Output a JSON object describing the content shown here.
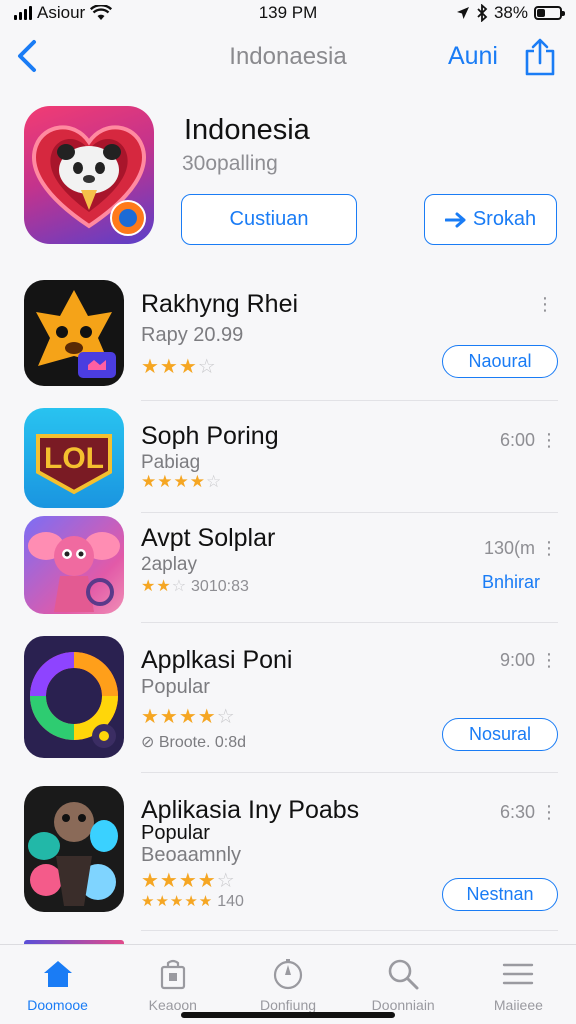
{
  "status_bar": {
    "carrier": "Asiour",
    "time": "139 PM",
    "battery": "38%",
    "battery_level": 0.38
  },
  "nav": {
    "title": "Indonaesia",
    "action": "Auni"
  },
  "hero": {
    "title": "Indonesia",
    "subtitle": "30opalling",
    "button_primary": "Custiuan",
    "button_secondary": "Srokah"
  },
  "apps": [
    {
      "name": "Rakhyng Rhei",
      "subtitle": "Rapy 20.99",
      "rating": 3.5,
      "stars": "★★★",
      "stars_off": "☆",
      "rating_count": "",
      "meta": "⋮",
      "button": "Naoural"
    },
    {
      "name": "Soph Poring",
      "subtitle": "Pabiag",
      "rating": 3.5,
      "stars": "★★★★",
      "stars_off": "☆",
      "rating_count": "",
      "meta": "6:00 ⋮",
      "button": ""
    },
    {
      "name": "Avpt Solplar",
      "subtitle": "2aplay",
      "rating": 2.5,
      "stars": "★★",
      "stars_off": "☆",
      "rating_count": "3010:83",
      "meta": "130(m ⋮",
      "link": "Bnhirar"
    },
    {
      "name": "Applkasi Poni",
      "subtitle": "Popular",
      "rating": 4,
      "stars": "★★★★",
      "stars_off": "☆",
      "extra": "⊘ Broote. 0:8d",
      "meta": "9:00 ⋮",
      "button": "Nosural"
    },
    {
      "name": "Aplikasia Iny Poabs",
      "subtitle": "Popular",
      "subtitle2": "Beoaamnly",
      "rating": 4,
      "stars": "★★★★",
      "stars_off": "☆",
      "stars_small": "★★★★★",
      "rating_count": "140",
      "meta": "6:30 ⋮",
      "button": "Nestnan"
    }
  ],
  "tabs": [
    {
      "label": "Doomooe",
      "icon": "home-icon",
      "active": true
    },
    {
      "label": "Keaoon",
      "icon": "bag-icon",
      "active": false
    },
    {
      "label": "Donfiung",
      "icon": "compass-icon",
      "active": false
    },
    {
      "label": "Doonniain",
      "icon": "search-icon",
      "active": false
    },
    {
      "label": "Maiieee",
      "icon": "menu-icon",
      "active": false
    }
  ],
  "colors": {
    "accent": "#1a7cf5",
    "star": "#f5a623",
    "muted": "#8e8e93"
  }
}
